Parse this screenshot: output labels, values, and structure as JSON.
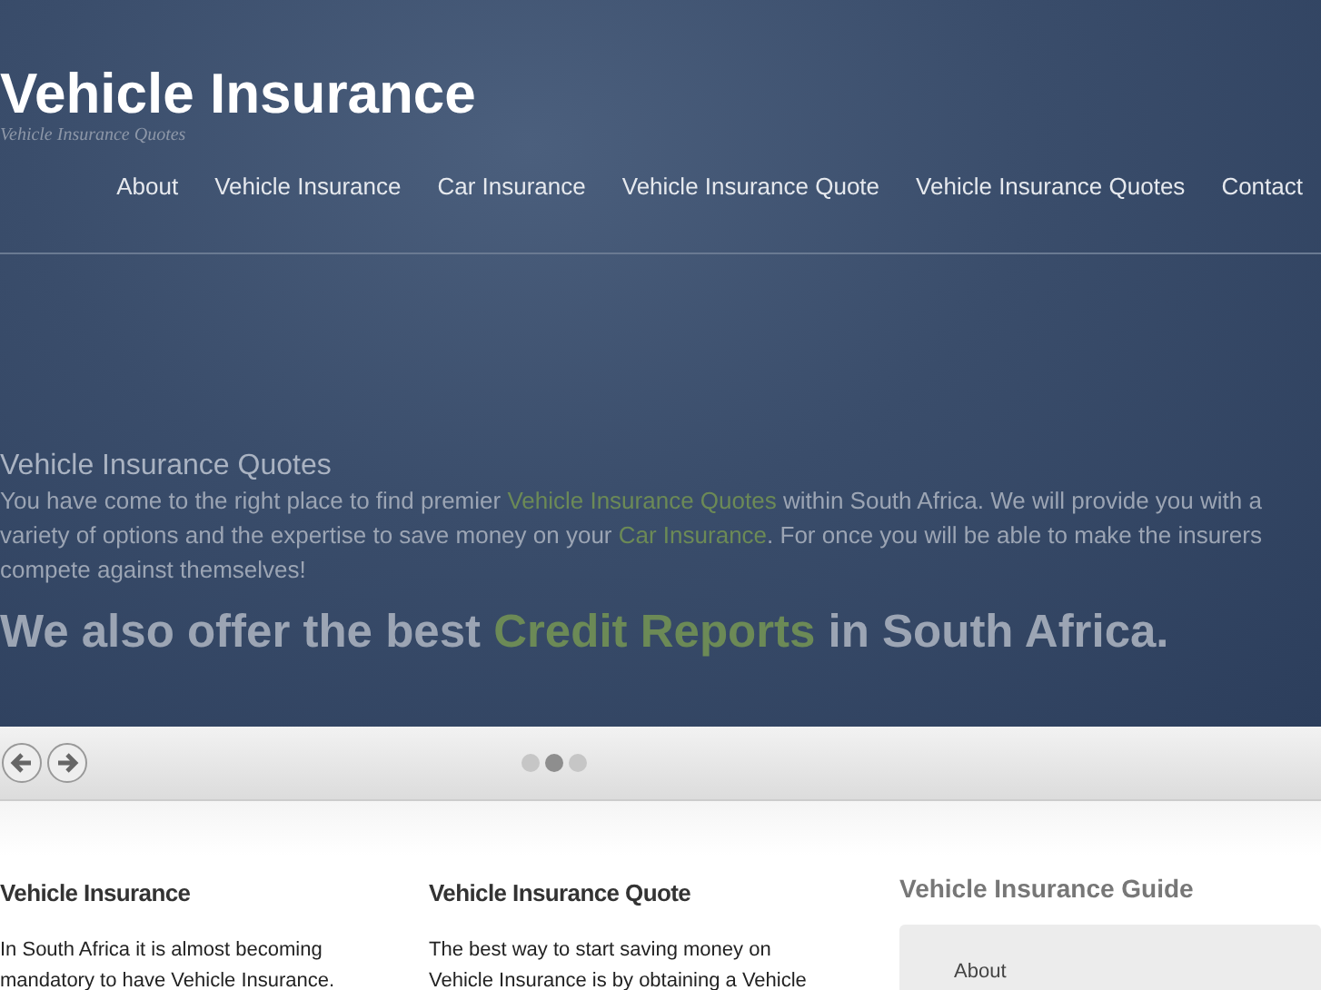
{
  "site": {
    "title": "Vehicle Insurance",
    "tagline": "Vehicle Insurance Quotes"
  },
  "nav": [
    {
      "label": "About"
    },
    {
      "label": "Vehicle Insurance"
    },
    {
      "label": "Car Insurance"
    },
    {
      "label": "Vehicle Insurance Quote"
    },
    {
      "label": "Vehicle Insurance Quotes"
    },
    {
      "label": "Contact"
    }
  ],
  "slide": {
    "heading": "Vehicle Insurance Quotes",
    "paragraph": [
      {
        "text": "You have come to the right place to find premier ",
        "link": false
      },
      {
        "text": "Vehicle Insurance Quotes",
        "link": true
      },
      {
        "text": " within South Africa.  We will provide you with a variety of options and the expertise to save money on your ",
        "link": false
      },
      {
        "text": "Car Insurance",
        "link": true
      },
      {
        "text": ".  For once you will be able to make the insurers compete against themselves!",
        "link": false
      }
    ],
    "headline": [
      {
        "text": "We also offer the best ",
        "link": false
      },
      {
        "text": "Credit Reports",
        "link": true
      },
      {
        "text": " in South Africa.",
        "link": false
      }
    ]
  },
  "slider_dots": [
    {
      "selected": false
    },
    {
      "selected": true
    },
    {
      "selected": false
    }
  ],
  "columns": [
    {
      "heading": "Vehicle Insurance",
      "text": "In South Africa it is almost becoming mandatory to have Vehicle Insurance."
    },
    {
      "heading": "Vehicle Insurance Quote",
      "text": "The best way to start saving money on Vehicle Insurance is by obtaining a Vehicle"
    }
  ],
  "sidebar": {
    "heading": "Vehicle Insurance Guide",
    "items": [
      {
        "label": "About"
      }
    ]
  }
}
